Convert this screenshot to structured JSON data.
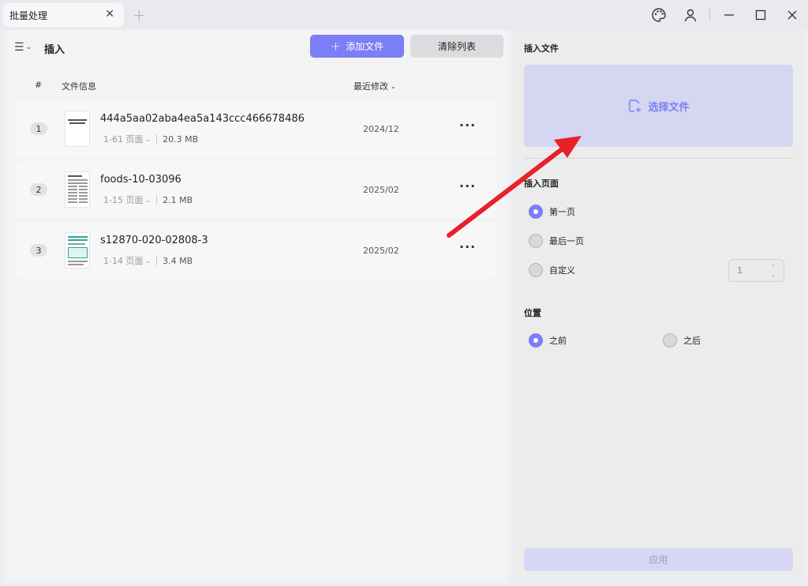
{
  "titlebar": {
    "tab_title": "批量处理",
    "close_glyph": "✕",
    "new_tab_glyph": "+",
    "icons": [
      "palette-icon",
      "user-icon",
      "minimize-icon",
      "maximize-icon",
      "close-icon"
    ]
  },
  "left": {
    "menu_glyph": "☰",
    "title": "插入",
    "add_button": "添加文件",
    "clear_button": "清除列表",
    "columns": {
      "num": "#",
      "info": "文件信息",
      "modified": "最近修改"
    },
    "files": [
      {
        "index": "1",
        "name": "444a5aa02aba4ea5a143ccc466678486",
        "pages": "1-61 页面",
        "size": "20.3 MB",
        "date": "2024/12"
      },
      {
        "index": "2",
        "name": "foods-10-03096",
        "pages": "1-15 页面",
        "size": "2.1 MB",
        "date": "2025/02"
      },
      {
        "index": "3",
        "name": "s12870-020-02808-3",
        "pages": "1-14 页面",
        "size": "3.4 MB",
        "date": "2025/02"
      }
    ],
    "more_glyph": "···"
  },
  "right": {
    "insert_file_label": "插入文件",
    "select_file": "选择文件",
    "insert_page_label": "插入页面",
    "page_options": [
      "第一页",
      "最后一页",
      "自定义"
    ],
    "page_selected": "第一页",
    "custom_page_value": "1",
    "position_label": "位置",
    "position_options": [
      "之前",
      "之后"
    ],
    "position_selected": "之前",
    "apply_button": "应用"
  },
  "colors": {
    "accent": "#7b7ef5",
    "annotation_arrow": "#e8202a"
  }
}
